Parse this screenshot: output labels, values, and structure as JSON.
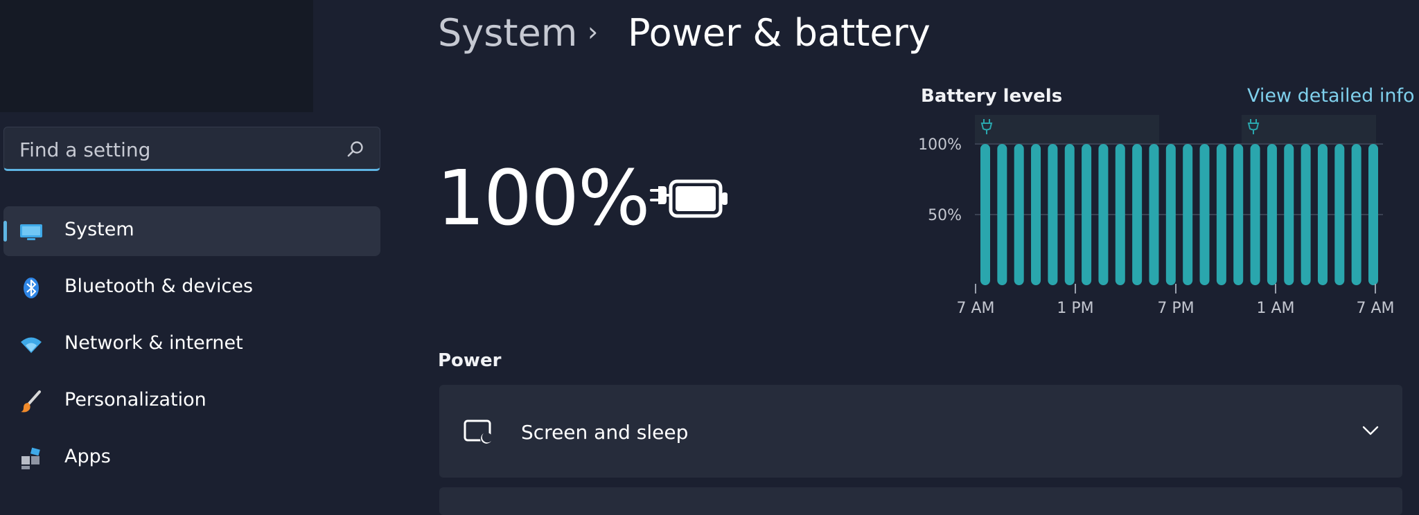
{
  "search": {
    "placeholder": "Find a setting",
    "icon": "search-icon"
  },
  "sidebar": {
    "items": [
      {
        "label": "System",
        "icon": "monitor-icon",
        "active": true
      },
      {
        "label": "Bluetooth & devices",
        "icon": "bluetooth-icon"
      },
      {
        "label": "Network & internet",
        "icon": "wifi-icon"
      },
      {
        "label": "Personalization",
        "icon": "brush-icon"
      },
      {
        "label": "Apps",
        "icon": "apps-icon"
      }
    ]
  },
  "header": {
    "parent": "System",
    "separator": "›",
    "current": "Power & battery"
  },
  "battery": {
    "percent": "100%",
    "icon": "battery-charging-icon"
  },
  "battery_chart": {
    "title": "Battery levels",
    "link": "View detailed info"
  },
  "chart_data": {
    "type": "bar",
    "title": "Battery levels",
    "ylim": [
      0,
      100
    ],
    "y_ticks": [
      "100%",
      "50%"
    ],
    "x_tick_labels": [
      "7 AM",
      "1 PM",
      "7 PM",
      "1 AM",
      "7 AM"
    ],
    "bar_count": 24,
    "values": [
      100,
      100,
      100,
      100,
      100,
      100,
      100,
      100,
      100,
      100,
      100,
      100,
      100,
      100,
      100,
      100,
      100,
      100,
      100,
      100,
      100,
      100,
      100,
      100
    ],
    "charging_markers": [
      "plug-icon",
      "plug-icon"
    ],
    "bar_color": "#2aa6ad"
  },
  "power": {
    "section_title": "Power",
    "items": [
      {
        "label": "Screen and sleep",
        "icon": "screen-sleep-icon",
        "expand_icon": "chevron-down-icon"
      }
    ]
  },
  "colors": {
    "accent": "#5fb5e3",
    "link": "#7fd0ec",
    "bar": "#2aa6ad",
    "background": "#1b2030"
  }
}
